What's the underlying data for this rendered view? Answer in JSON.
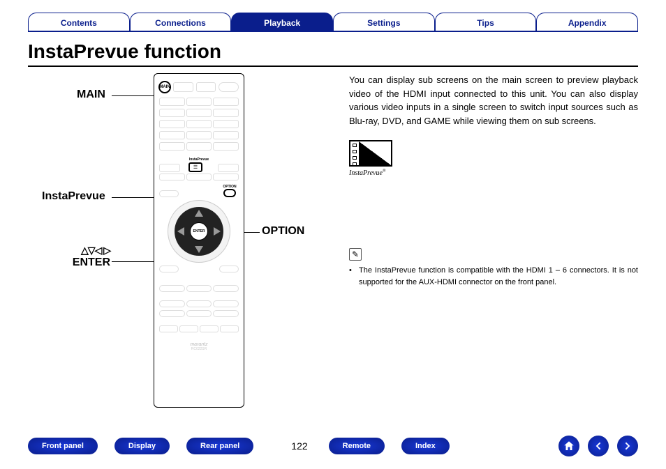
{
  "nav": {
    "tabs": [
      "Contents",
      "Connections",
      "Playback",
      "Settings",
      "Tips",
      "Appendix"
    ],
    "active_index": 2
  },
  "title": "InstaPrevue function",
  "callouts": {
    "main": "MAIN",
    "instaprevue": "InstaPrevue",
    "option": "OPTION",
    "arrows": "△▽◁ ▷",
    "enter": "ENTER"
  },
  "remote": {
    "enter_label": "ENTER",
    "instaprevue_tiny": "InstaPrevue",
    "option_tiny": "OPTION",
    "brand": "marantz",
    "model": "RC022SR"
  },
  "body": {
    "paragraph": "You can display sub screens on the main screen to preview playback video of the HDMI input connected to this unit. You can also display various video inputs in a single screen to switch input sources such as Blu-ray, DVD, and GAME while viewing them on sub screens.",
    "logo_text": "InstaPrevue",
    "note_icon": "✎",
    "note_bullet": "The InstaPrevue function is compatible with the HDMI 1 – 6 connectors. It is not supported for the AUX-HDMI connector on the front panel."
  },
  "footer": {
    "buttons": [
      "Front panel",
      "Display",
      "Rear panel"
    ],
    "page": "122",
    "buttons2": [
      "Remote",
      "Index"
    ],
    "icons": {
      "home": "⌂",
      "back": "←",
      "forward": "→"
    }
  }
}
